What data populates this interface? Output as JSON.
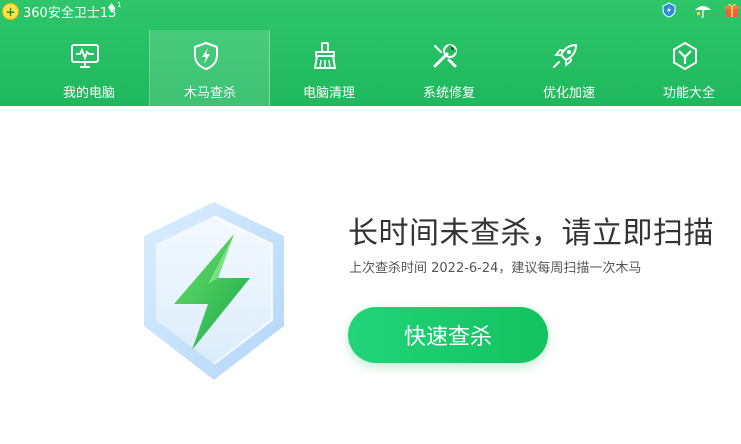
{
  "titlebar": {
    "app_title": "360安全卫士13",
    "version_badge": "1"
  },
  "nav": {
    "items": [
      {
        "label": "我的电脑",
        "icon": "monitor-icon"
      },
      {
        "label": "木马查杀",
        "icon": "shield-lightning-icon",
        "active": true
      },
      {
        "label": "电脑清理",
        "icon": "broom-icon"
      },
      {
        "label": "系统修复",
        "icon": "wrench-icon"
      },
      {
        "label": "优化加速",
        "icon": "rocket-icon"
      },
      {
        "label": "功能大全",
        "icon": "hexagon-y-icon"
      }
    ]
  },
  "main": {
    "heading": "长时间未查杀，请立即扫描",
    "subtext": "上次查杀时间 2022-6-24，建议每周扫描一次木马",
    "scan_button": "快速查杀"
  },
  "colors": {
    "header_green": "#1fb85d",
    "button_green": "#22d47a",
    "heading_text": "#333333"
  }
}
